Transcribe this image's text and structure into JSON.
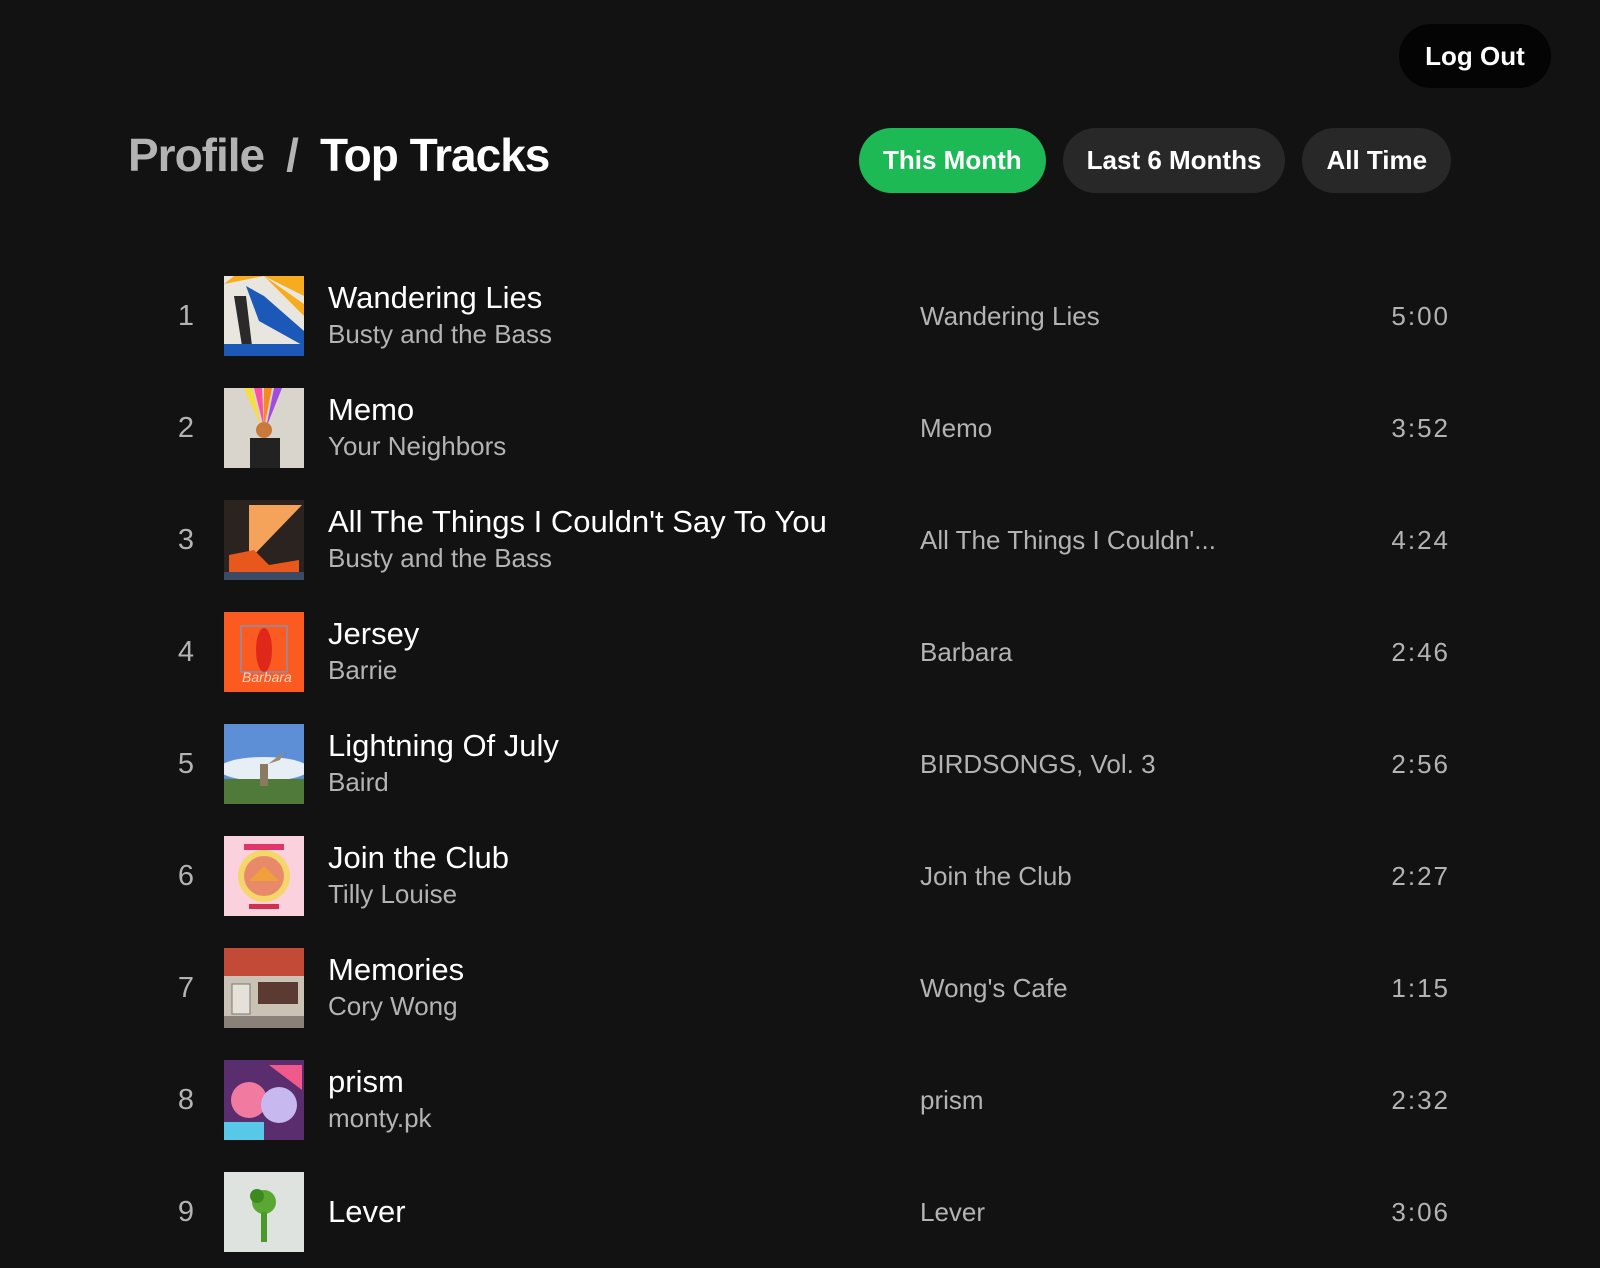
{
  "header": {
    "logout_label": "Log Out",
    "breadcrumb": {
      "parent": "Profile",
      "separator": "/",
      "current": "Top Tracks"
    }
  },
  "time_ranges": [
    {
      "label": "This Month",
      "active": true
    },
    {
      "label": "Last 6 Months",
      "active": false
    },
    {
      "label": "All Time",
      "active": false
    }
  ],
  "colors": {
    "accent": "#1db954",
    "background": "#121212",
    "muted_text": "#b3b3b3",
    "chip": "#282828"
  },
  "tracks": [
    {
      "rank": "1",
      "title": "Wandering Lies",
      "artist": "Busty and the Bass",
      "album": "Wandering Lies",
      "duration": "5:00",
      "cover": "wandering-lies"
    },
    {
      "rank": "2",
      "title": "Memo",
      "artist": "Your Neighbors",
      "album": "Memo",
      "duration": "3:52",
      "cover": "memo"
    },
    {
      "rank": "3",
      "title": "All The Things I Couldn't Say To You",
      "artist": "Busty and the Bass",
      "album": "All The Things I Couldn'...",
      "duration": "4:24",
      "cover": "all-the-things"
    },
    {
      "rank": "4",
      "title": "Jersey",
      "artist": "Barrie",
      "album": "Barbara",
      "duration": "2:46",
      "cover": "barbara"
    },
    {
      "rank": "5",
      "title": "Lightning Of July",
      "artist": "Baird",
      "album": "BIRDSONGS, Vol. 3",
      "duration": "2:56",
      "cover": "birdsongs"
    },
    {
      "rank": "6",
      "title": "Join the Club",
      "artist": "Tilly Louise",
      "album": "Join the Club",
      "duration": "2:27",
      "cover": "join-the-club"
    },
    {
      "rank": "7",
      "title": "Memories",
      "artist": "Cory Wong",
      "album": "Wong's Cafe",
      "duration": "1:15",
      "cover": "wongs-cafe"
    },
    {
      "rank": "8",
      "title": "prism",
      "artist": "monty.pk",
      "album": "prism",
      "duration": "2:32",
      "cover": "prism"
    },
    {
      "rank": "9",
      "title": "Lever",
      "artist": "",
      "album": "Lever",
      "duration": "3:06",
      "cover": "lever"
    }
  ]
}
